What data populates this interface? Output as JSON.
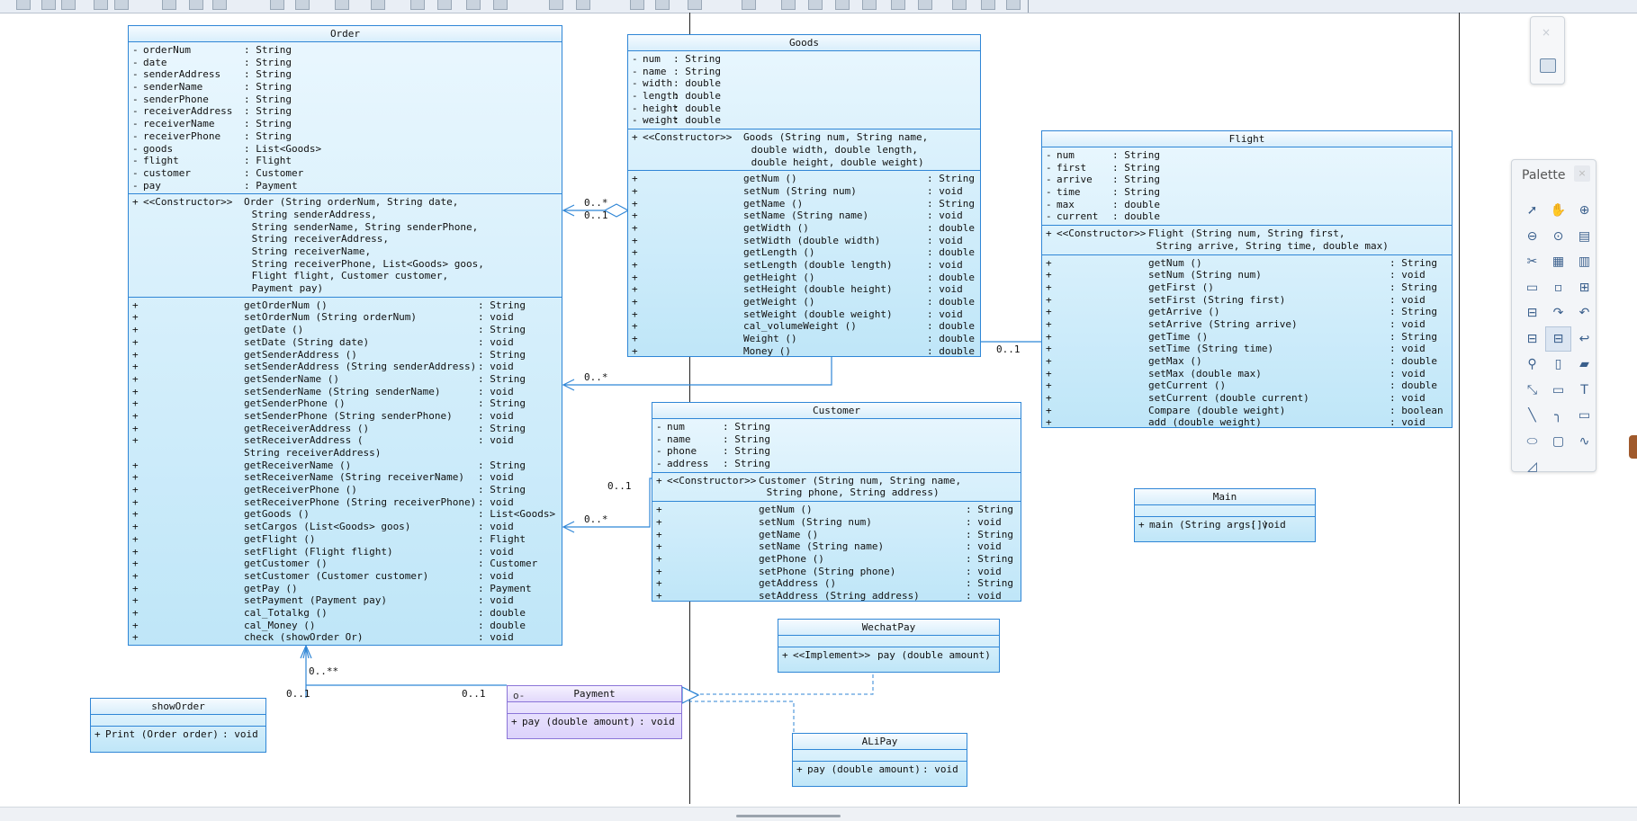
{
  "canvas": {
    "background": "#ffffff"
  },
  "colors": {
    "class_border": "#2f86d6",
    "class_fill": "#bfe6f8",
    "interface_border": "#8a74d8",
    "interface_fill": "#dcd2fb",
    "link": "#2f86d6"
  },
  "classes": {
    "order": {
      "name": "Order",
      "attributes": [
        {
          "vis": "-",
          "name": "orderNum",
          "type": ": String"
        },
        {
          "vis": "-",
          "name": "date",
          "type": ": String"
        },
        {
          "vis": "-",
          "name": "senderAddress",
          "type": ": String"
        },
        {
          "vis": "-",
          "name": "senderName",
          "type": ": String"
        },
        {
          "vis": "-",
          "name": "senderPhone",
          "type": ": String"
        },
        {
          "vis": "-",
          "name": "receiverAddress",
          "type": ": String"
        },
        {
          "vis": "-",
          "name": "receiverName",
          "type": ": String"
        },
        {
          "vis": "-",
          "name": "receiverPhone",
          "type": ": String"
        },
        {
          "vis": "-",
          "name": "goods",
          "type": ": List<Goods>"
        },
        {
          "vis": "-",
          "name": "flight",
          "type": ": Flight"
        },
        {
          "vis": "-",
          "name": "customer",
          "type": ": Customer"
        },
        {
          "vis": "-",
          "name": "pay",
          "type": ": Payment"
        }
      ],
      "constructor": {
        "vis": "+",
        "stereotype": "<<Constructor>>",
        "lines": [
          "Order (String orderNum, String date,",
          " String senderAddress,",
          " String senderName, String senderPhone,",
          " String receiverAddress,",
          " String receiverName,",
          " String receiverPhone, List<Goods> goos,",
          " Flight flight, Customer customer,",
          " Payment pay)"
        ]
      },
      "methods": [
        {
          "vis": "+",
          "sig": "getOrderNum ()",
          "ret": ": String"
        },
        {
          "vis": "+",
          "sig": "setOrderNum (String orderNum)",
          "ret": ": void"
        },
        {
          "vis": "+",
          "sig": "getDate ()",
          "ret": ": String"
        },
        {
          "vis": "+",
          "sig": "setDate (String date)",
          "ret": ": void"
        },
        {
          "vis": "+",
          "sig": "getSenderAddress ()",
          "ret": ": String"
        },
        {
          "vis": "+",
          "sig": "setSenderAddress (String senderAddress)",
          "ret": ": void"
        },
        {
          "vis": "+",
          "sig": "getSenderName ()",
          "ret": ": String"
        },
        {
          "vis": "+",
          "sig": "setSenderName (String senderName)",
          "ret": ": void"
        },
        {
          "vis": "+",
          "sig": "getSenderPhone ()",
          "ret": ": String"
        },
        {
          "vis": "+",
          "sig": "setSenderPhone (String senderPhone)",
          "ret": ": void"
        },
        {
          "vis": "+",
          "sig": "getReceiverAddress ()",
          "ret": ": String"
        },
        {
          "vis": "+",
          "sig": "setReceiverAddress (",
          "ret": ": void",
          "cont": "String receiverAddress)"
        },
        {
          "vis": "+",
          "sig": "getReceiverName ()",
          "ret": ": String"
        },
        {
          "vis": "+",
          "sig": "setReceiverName (String receiverName)",
          "ret": ": void"
        },
        {
          "vis": "+",
          "sig": "getReceiverPhone ()",
          "ret": ": String"
        },
        {
          "vis": "+",
          "sig": "setReceiverPhone (String receiverPhone)",
          "ret": ": void"
        },
        {
          "vis": "+",
          "sig": "getGoods ()",
          "ret": ": List<Goods>"
        },
        {
          "vis": "+",
          "sig": "setCargos (List<Goods> goos)",
          "ret": ": void"
        },
        {
          "vis": "+",
          "sig": "getFlight ()",
          "ret": ": Flight"
        },
        {
          "vis": "+",
          "sig": "setFlight (Flight flight)",
          "ret": ": void"
        },
        {
          "vis": "+",
          "sig": "getCustomer ()",
          "ret": ": Customer"
        },
        {
          "vis": "+",
          "sig": "setCustomer (Customer customer)",
          "ret": ": void"
        },
        {
          "vis": "+",
          "sig": "getPay ()",
          "ret": ": Payment"
        },
        {
          "vis": "+",
          "sig": "setPayment (Payment pay)",
          "ret": ": void"
        },
        {
          "vis": "+",
          "sig": "cal_Totalkg ()",
          "ret": ": double"
        },
        {
          "vis": "+",
          "sig": "cal_Money ()",
          "ret": ": double"
        },
        {
          "vis": "+",
          "sig": "check (showOrder Or)",
          "ret": ": void"
        }
      ]
    },
    "goods": {
      "name": "Goods",
      "attributes": [
        {
          "vis": "-",
          "name": "num",
          "type": ": String"
        },
        {
          "vis": "-",
          "name": "name",
          "type": ": String"
        },
        {
          "vis": "-",
          "name": "width",
          "type": ": double"
        },
        {
          "vis": "-",
          "name": "length",
          "type": ": double"
        },
        {
          "vis": "-",
          "name": "height",
          "type": ": double"
        },
        {
          "vis": "-",
          "name": "weight",
          "type": ": double"
        }
      ],
      "constructor": {
        "vis": "+",
        "stereotype": "<<Constructor>>",
        "lines": [
          "Goods (String num, String name,",
          " double width, double length,",
          " double height, double weight)"
        ]
      },
      "methods": [
        {
          "vis": "+",
          "sig": "getNum ()",
          "ret": ": String"
        },
        {
          "vis": "+",
          "sig": "setNum (String num)",
          "ret": ": void"
        },
        {
          "vis": "+",
          "sig": "getName ()",
          "ret": ": String"
        },
        {
          "vis": "+",
          "sig": "setName (String name)",
          "ret": ": void"
        },
        {
          "vis": "+",
          "sig": "getWidth ()",
          "ret": ": double"
        },
        {
          "vis": "+",
          "sig": "setWidth (double width)",
          "ret": ": void"
        },
        {
          "vis": "+",
          "sig": "getLength ()",
          "ret": ": double"
        },
        {
          "vis": "+",
          "sig": "setLength (double length)",
          "ret": ": void"
        },
        {
          "vis": "+",
          "sig": "getHeight ()",
          "ret": ": double"
        },
        {
          "vis": "+",
          "sig": "setHeight (double height)",
          "ret": ": void"
        },
        {
          "vis": "+",
          "sig": "getWeight ()",
          "ret": ": double"
        },
        {
          "vis": "+",
          "sig": "setWeight (double weight)",
          "ret": ": void"
        },
        {
          "vis": "+",
          "sig": "cal_volumeWeight ()",
          "ret": ": double"
        },
        {
          "vis": "+",
          "sig": "Weight ()",
          "ret": ": double"
        },
        {
          "vis": "+",
          "sig": "Money ()",
          "ret": ": double"
        }
      ]
    },
    "flight": {
      "name": "Flight",
      "attributes": [
        {
          "vis": "-",
          "name": "num",
          "type": ": String"
        },
        {
          "vis": "-",
          "name": "first",
          "type": ": String"
        },
        {
          "vis": "-",
          "name": "arrive",
          "type": ": String"
        },
        {
          "vis": "-",
          "name": "time",
          "type": ": String"
        },
        {
          "vis": "-",
          "name": "max",
          "type": ": double"
        },
        {
          "vis": "-",
          "name": "current",
          "type": ": double"
        }
      ],
      "constructor": {
        "vis": "+",
        "stereotype": "<<Constructor>>",
        "lines": [
          "Flight (String num, String first,",
          " String arrive, String time, double max)"
        ]
      },
      "methods": [
        {
          "vis": "+",
          "sig": "getNum ()",
          "ret": ": String"
        },
        {
          "vis": "+",
          "sig": "setNum (String num)",
          "ret": ": void"
        },
        {
          "vis": "+",
          "sig": "getFirst ()",
          "ret": ": String"
        },
        {
          "vis": "+",
          "sig": "setFirst (String first)",
          "ret": ": void"
        },
        {
          "vis": "+",
          "sig": "getArrive ()",
          "ret": ": String"
        },
        {
          "vis": "+",
          "sig": "setArrive (String arrive)",
          "ret": ": void"
        },
        {
          "vis": "+",
          "sig": "getTime ()",
          "ret": ": String"
        },
        {
          "vis": "+",
          "sig": "setTime (String time)",
          "ret": ": void"
        },
        {
          "vis": "+",
          "sig": "getMax ()",
          "ret": ": double"
        },
        {
          "vis": "+",
          "sig": "setMax (double max)",
          "ret": ": void"
        },
        {
          "vis": "+",
          "sig": "getCurrent ()",
          "ret": ": double"
        },
        {
          "vis": "+",
          "sig": "setCurrent (double current)",
          "ret": ": void"
        },
        {
          "vis": "+",
          "sig": "Compare (double weight)",
          "ret": ": boolean"
        },
        {
          "vis": "+",
          "sig": "add (double weight)",
          "ret": ": void"
        }
      ]
    },
    "customer": {
      "name": "Customer",
      "attributes": [
        {
          "vis": "-",
          "name": "num",
          "type": ": String"
        },
        {
          "vis": "-",
          "name": "name",
          "type": ": String"
        },
        {
          "vis": "-",
          "name": "phone",
          "type": ": String"
        },
        {
          "vis": "-",
          "name": "address",
          "type": ": String"
        }
      ],
      "constructor": {
        "vis": "+",
        "stereotype": "<<Constructor>>",
        "lines": [
          "Customer (String num, String name,",
          " String phone, String address)"
        ]
      },
      "methods": [
        {
          "vis": "+",
          "sig": "getNum ()",
          "ret": ": String"
        },
        {
          "vis": "+",
          "sig": "setNum (String num)",
          "ret": ": void"
        },
        {
          "vis": "+",
          "sig": "getName ()",
          "ret": ": String"
        },
        {
          "vis": "+",
          "sig": "setName (String name)",
          "ret": ": void"
        },
        {
          "vis": "+",
          "sig": "getPhone ()",
          "ret": ": String"
        },
        {
          "vis": "+",
          "sig": "setPhone (String phone)",
          "ret": ": void"
        },
        {
          "vis": "+",
          "sig": "getAddress ()",
          "ret": ": String"
        },
        {
          "vis": "+",
          "sig": "setAddress (String address)",
          "ret": ": void"
        }
      ]
    },
    "main": {
      "name": "Main",
      "methods": [
        {
          "vis": "+",
          "sig": "main (String args[])",
          "ret": ": void"
        }
      ]
    },
    "wechatpay": {
      "name": "WechatPay",
      "methods": [
        {
          "vis": "+",
          "stereotype": "<<Implement>>",
          "sig": "pay (double amount)",
          "ret": ":"
        }
      ]
    },
    "alipay": {
      "name": "ALiPay",
      "methods": [
        {
          "vis": "+",
          "sig": "pay (double amount)",
          "ret": ": void"
        }
      ]
    },
    "showorder": {
      "name": "showOrder",
      "methods": [
        {
          "vis": "+",
          "sig": "Print (Order order)",
          "ret": ": void"
        }
      ]
    },
    "payment": {
      "name": "Payment",
      "interface_glyph": "o-",
      "methods": [
        {
          "vis": "+",
          "sig": "pay (double amount)",
          "ret": ": void"
        }
      ]
    }
  },
  "multiplicities": {
    "goods_many": "0..*",
    "goods_one": "0..1",
    "flight_many": "0..*",
    "flight_one": "0..1",
    "customer_one": "0..1",
    "customer_many": "0..*",
    "showorder_many": "0..**",
    "showorder_one": "0..1",
    "payment_one": "0..1"
  },
  "palette": {
    "title": "Palette",
    "close": "×",
    "tools": [
      "select-icon",
      "hand-icon",
      "zoom-in-icon",
      "zoom-out-icon",
      "zoom-fit-icon",
      "properties-icon",
      "cut-icon",
      "class-icon",
      "table-icon",
      "note-icon",
      "small-box-icon",
      "hierarchy-icon",
      "tree-icon",
      "link-icon",
      "association-icon",
      "tree2-icon",
      "tree-selected-icon",
      "dependency-icon",
      "pin-icon",
      "document-icon",
      "note2-icon",
      "connector-icon",
      "drum-icon",
      "text-icon",
      "line-icon",
      "arc-icon",
      "rectangle-icon",
      "ellipse-icon",
      "rounded-rect-icon",
      "polyline-icon",
      "freeform-icon"
    ],
    "glyphs": [
      "➚",
      "✋",
      "⊕",
      "⊖",
      "⊙",
      "▤",
      "✂",
      "▦",
      "▥",
      "▭",
      "▫",
      "⊞",
      "⊟",
      "↷",
      "↶",
      "⊟",
      "⊟",
      "↩",
      "⚲",
      "▯",
      "▰",
      "⤡",
      "▭",
      "T",
      "╲",
      "╮",
      "▭",
      "⬭",
      "▢",
      "∿",
      "◿"
    ]
  },
  "mini_panel": {
    "close": "×"
  }
}
